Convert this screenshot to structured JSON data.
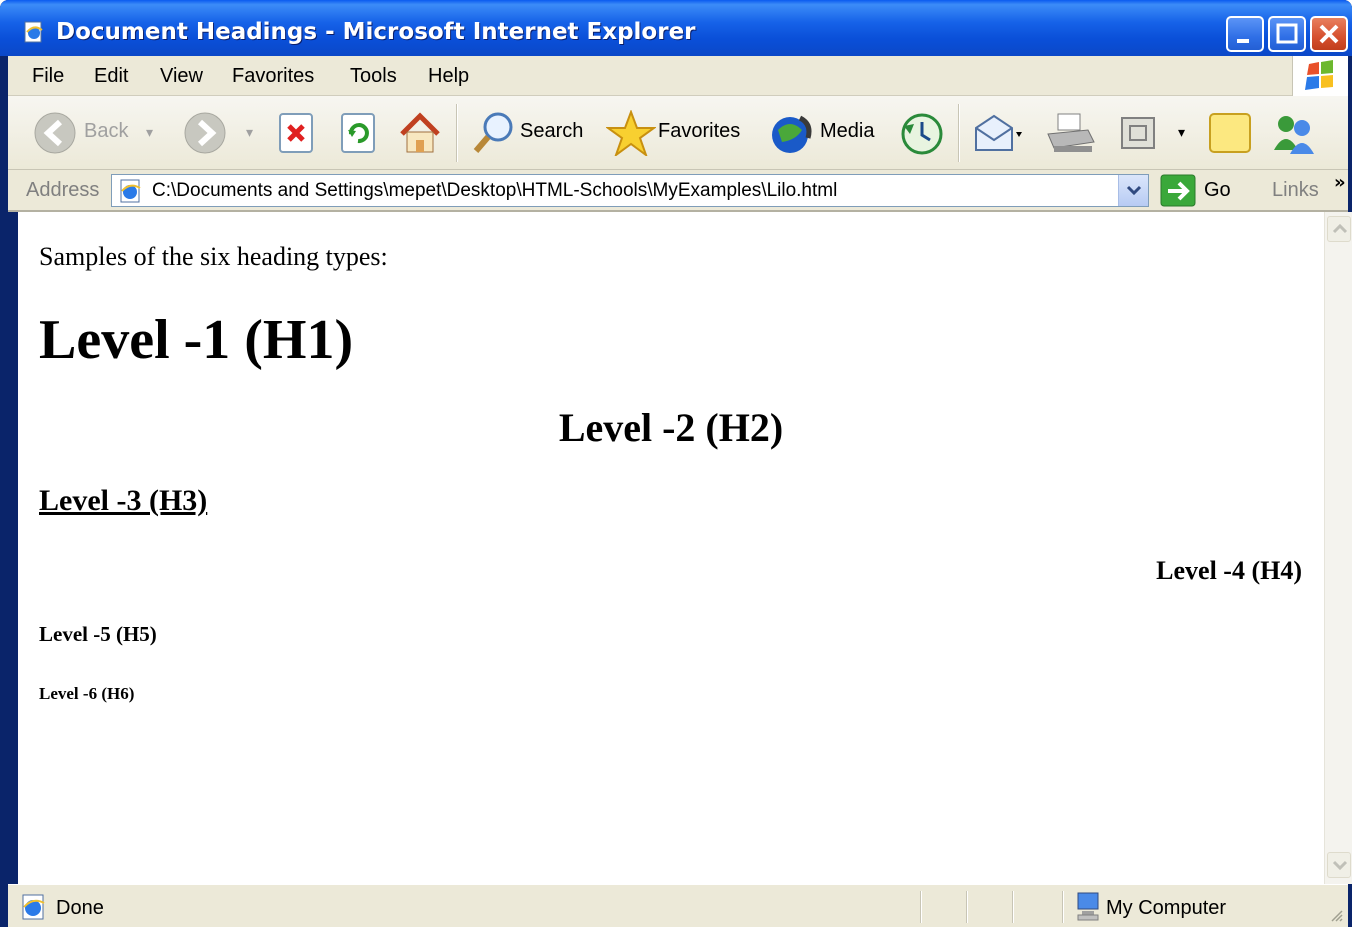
{
  "window": {
    "title": "Document Headings - Microsoft Internet Explorer",
    "accent": "#0a5bf0"
  },
  "menu": {
    "items": [
      {
        "label": "File"
      },
      {
        "label": "Edit"
      },
      {
        "label": "View"
      },
      {
        "label": "Favorites"
      },
      {
        "label": "Tools"
      },
      {
        "label": "Help"
      }
    ]
  },
  "toolbar": {
    "back_label": "Back",
    "search_label": "Search",
    "favorites_label": "Favorites",
    "media_label": "Media",
    "icons": [
      "back-icon",
      "forward-icon",
      "stop-icon",
      "refresh-icon",
      "home-icon",
      "search-icon",
      "favorites-star-icon",
      "media-icon",
      "history-icon",
      "mail-icon",
      "print-icon",
      "edit-icon",
      "discuss-icon",
      "messenger-icon"
    ]
  },
  "address": {
    "label": "Address",
    "url": "C:\\Documents and Settings\\mepet\\Desktop\\HTML-Schools\\MyExamples\\Lilo.html",
    "go_label": "Go",
    "links_label": "Links",
    "links_chevron": "»"
  },
  "content": {
    "intro": "Samples of the six heading types:",
    "h1": "Level -1 (H1)",
    "h2": "Level -2 (H2)",
    "h3": "Level -3 (H3)",
    "h4": "Level -4 (H4)",
    "h5": "Level -5 (H5)",
    "h6": "Level -6 (H6)"
  },
  "status": {
    "text": "Done",
    "zone": "My Computer"
  }
}
